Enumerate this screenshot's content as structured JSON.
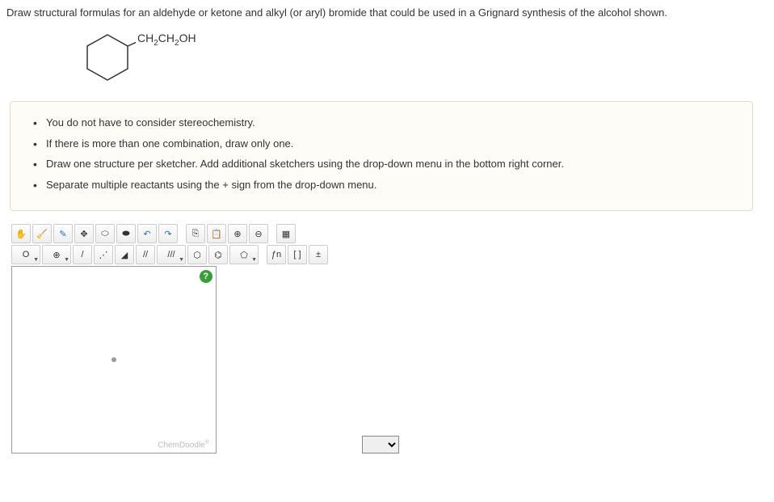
{
  "question": "Draw structural formulas for an aldehyde or ketone and alkyl (or aryl) bromide that could be used in a Grignard synthesis of the alcohol shown.",
  "molecule_label": "CH₂CH₂OH",
  "instructions": [
    "You do not have to consider stereochemistry.",
    "If there is more than one combination, draw only one.",
    "Draw one structure per sketcher. Add additional sketchers using the drop-down menu in the bottom right corner.",
    "Separate multiple reactants using the + sign from the drop-down menu."
  ],
  "toolbar_row1": {
    "hand": "✋",
    "erase": "🧹",
    "pencil": "✎",
    "move": "✥",
    "lasso": "⬭",
    "lasso2": "⬬",
    "undo": "↶",
    "redo": "↷",
    "copy": "⎘",
    "paste": "📋",
    "zoomin": "⊕",
    "zoomout": "⊖",
    "color": "▦"
  },
  "toolbar_row2": {
    "atom": "O",
    "charge": "⊕",
    "bond_single": "/",
    "bond_dotted": "⋰",
    "bond_wedge": "◢",
    "bond_double": "//",
    "bond_triple": "///",
    "ring_hex": "⬡",
    "ring_benz": "⌬",
    "ring_pent": "⬠",
    "func": "ƒn",
    "bracket": "[ ]",
    "charge2": "±"
  },
  "canvas": {
    "help": "?",
    "branding": "ChemDoodle"
  }
}
